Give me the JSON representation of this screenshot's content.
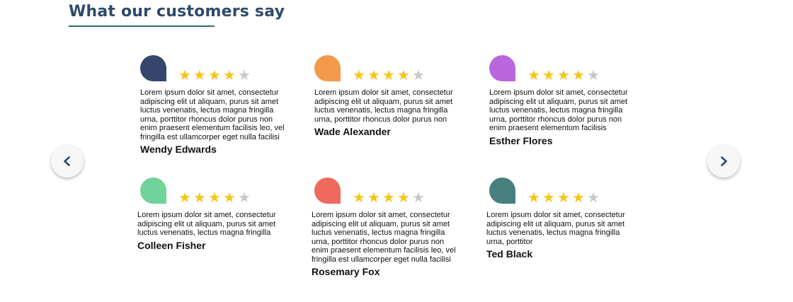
{
  "section": {
    "title": "What our customers say"
  },
  "colors": {
    "title": "#2f4a6a",
    "star_on": "#f5c518",
    "star_off": "#c8c8c8"
  },
  "nav": {
    "prev_icon": "chevron-left-icon",
    "next_icon": "chevron-right-icon"
  },
  "testimonials": [
    {
      "name": "Wendy Edwards",
      "rating": 4,
      "avatar_color": "#34466a",
      "text": "Lorem ipsum dolor sit amet, consectetur adipiscing elit ut aliquam, purus sit amet luctus venenatis, lectus magna fringilla urna, porttitor rhoncus dolor purus non enim praesent elementum facilisis leo, vel fringilla est ullamcorper eget nulla facilisi"
    },
    {
      "name": "Wade Alexander",
      "rating": 4,
      "avatar_color": "#f29a4a",
      "text": "Lorem ipsum dolor sit amet, consectetur adipiscing elit ut aliquam, purus sit amet luctus venenatis, lectus magna fringilla urna, porttitor rhoncus dolor purus non"
    },
    {
      "name": "Esther Flores",
      "rating": 4,
      "avatar_color": "#b967dc",
      "text": "Lorem ipsum dolor sit amet, consectetur adipiscing elit ut aliquam, purus sit amet luctus venenatis, lectus magna fringilla urna, porttitor rhoncus dolor purus non enim praesent elementum facilisis"
    },
    {
      "name": "Colleen Fisher",
      "rating": 4,
      "avatar_color": "#6fd39a",
      "text": "Lorem ipsum dolor sit amet, consectetur adipiscing elit ut aliquam, purus sit amet luctus venenatis, lectus magna fringilla"
    },
    {
      "name": "Rosemary Fox",
      "rating": 4,
      "avatar_color": "#ee6a5c",
      "text": "Lorem ipsum dolor sit amet, consectetur adipiscing elit ut aliquam, purus sit amet luctus venenatis, lectus magna fringilla urna, porttitor rhoncus dolor purus non enim praesent elementum facilisis leo, vel fringilla est ullamcorper eget nulla facilisi"
    },
    {
      "name": "Ted Black",
      "rating": 4,
      "avatar_color": "#457f7e",
      "text": "Lorem ipsum dolor sit amet, consectetur adipiscing elit ut aliquam, purus sit amet luctus venenatis, lectus magna fringilla urna, porttitor"
    }
  ]
}
